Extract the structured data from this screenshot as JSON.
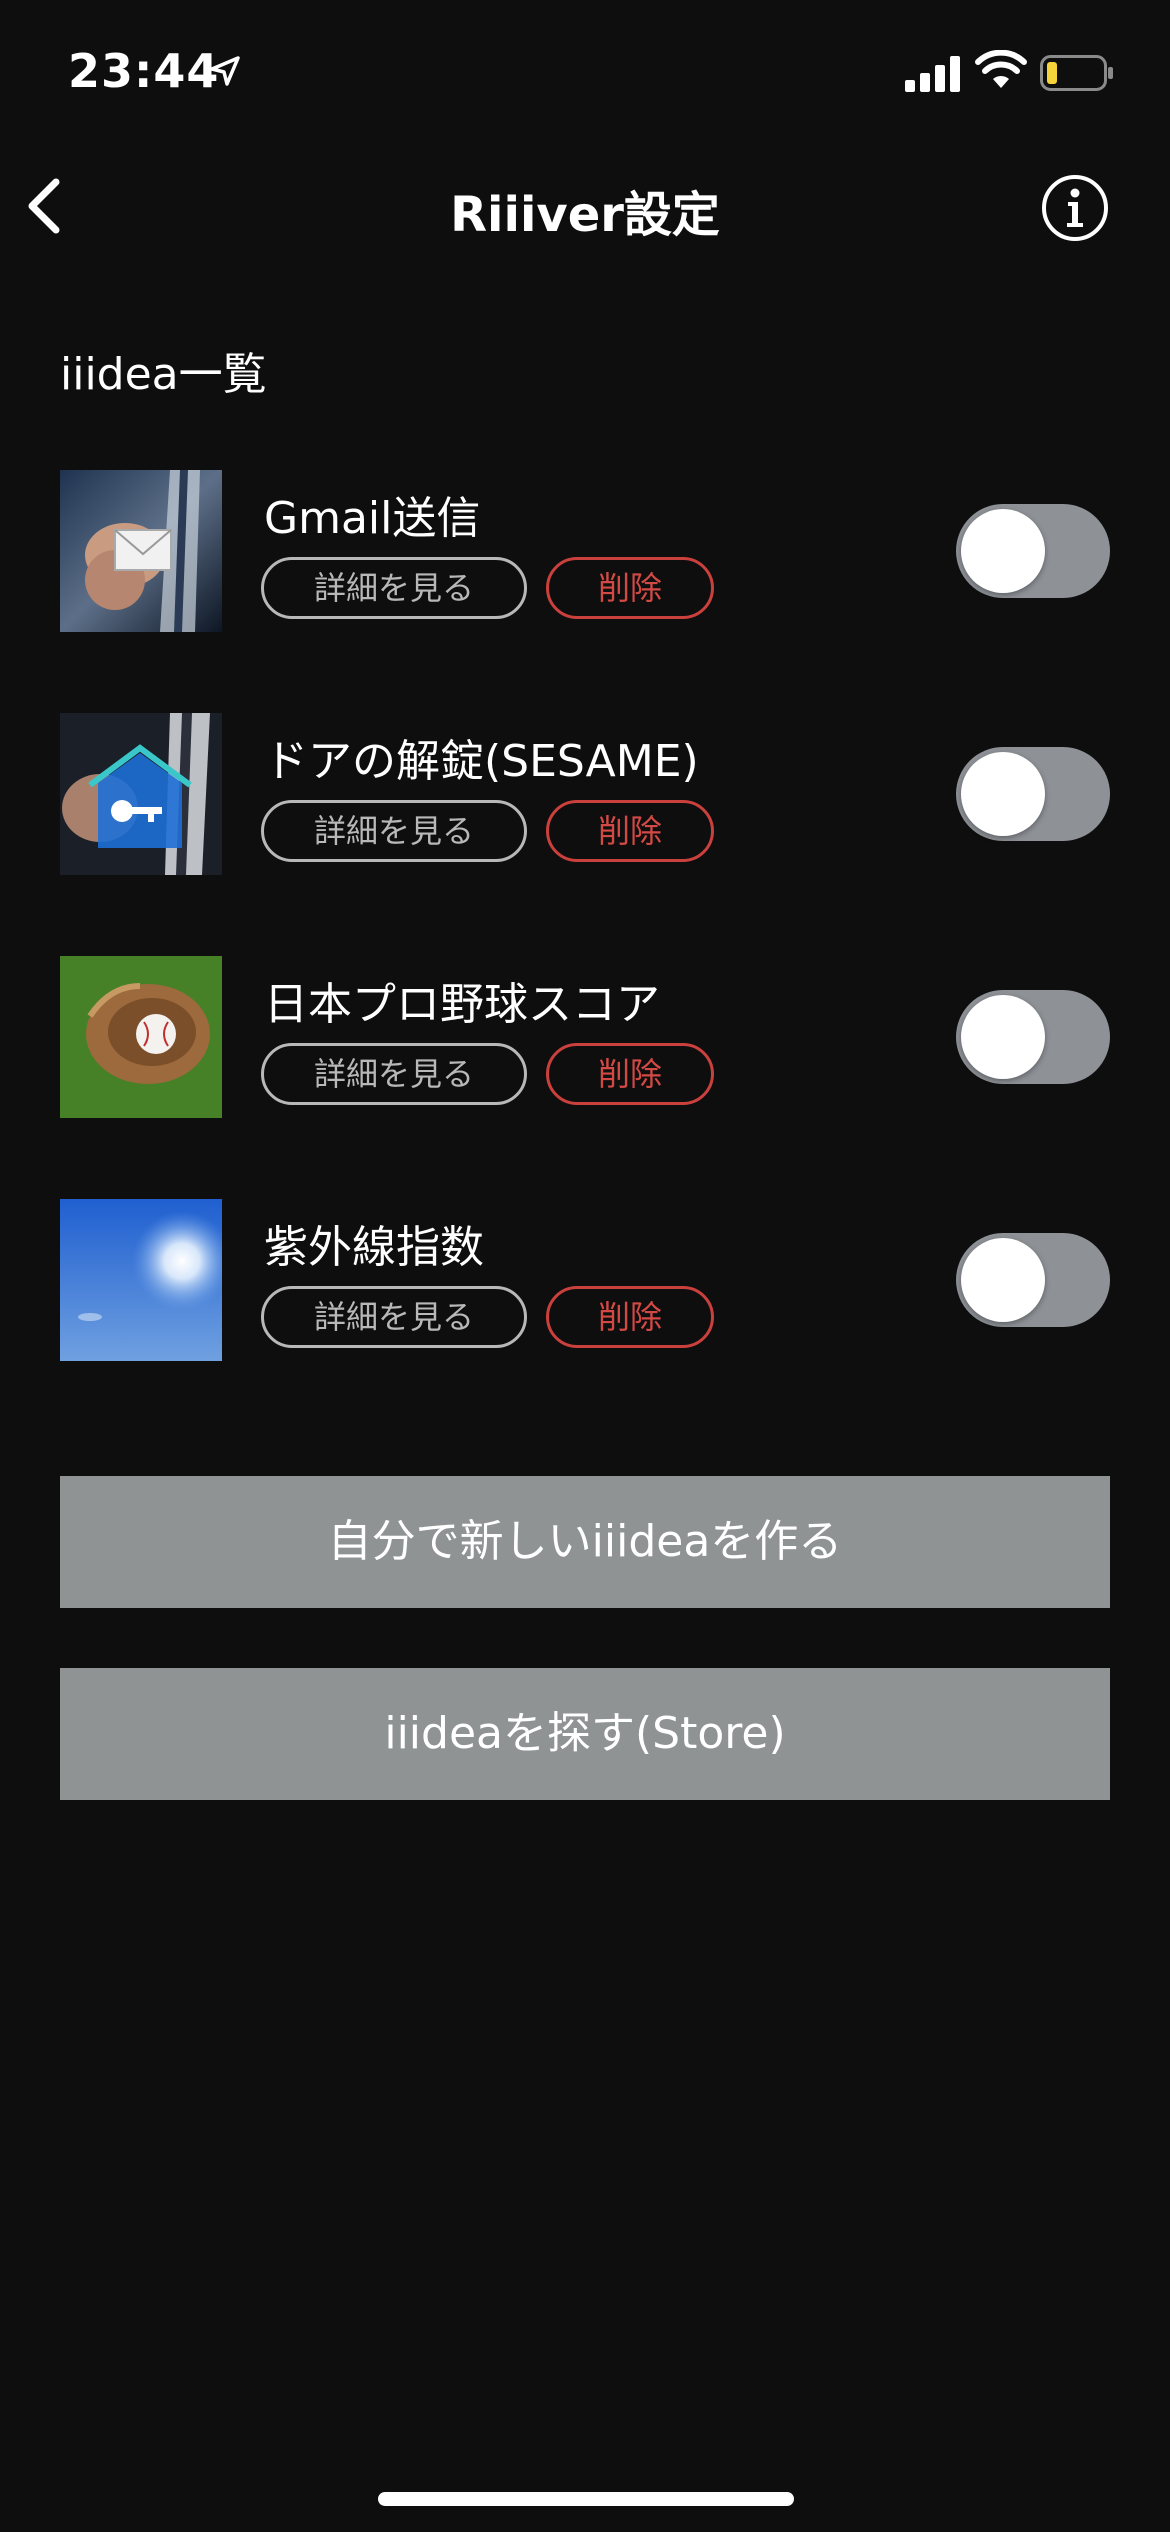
{
  "status_bar": {
    "time": "23:44",
    "icons": [
      "location-arrow-icon",
      "signal-icon",
      "wifi-icon",
      "battery-icon"
    ],
    "battery_color": "#f5d33b"
  },
  "header": {
    "title": "Riiiver設定",
    "back_icon": "chevron-left-icon",
    "info_icon": "info-icon"
  },
  "section": {
    "title": "iiidea一覧"
  },
  "ideas": [
    {
      "name": "Gmail送信",
      "detail_label": "詳細を見る",
      "delete_label": "削除",
      "enabled": false,
      "thumbnail": "hand-envelope-image"
    },
    {
      "name": "ドアの解錠(SESAME)",
      "detail_label": "詳細を見る",
      "delete_label": "削除",
      "enabled": false,
      "thumbnail": "hand-house-key-image"
    },
    {
      "name": "日本プロ野球スコア",
      "detail_label": "詳細を見る",
      "delete_label": "削除",
      "enabled": false,
      "thumbnail": "baseball-glove-image"
    },
    {
      "name": "紫外線指数",
      "detail_label": "詳細を見る",
      "delete_label": "削除",
      "enabled": false,
      "thumbnail": "sun-sky-image"
    }
  ],
  "actions": {
    "create_label": "自分で新しいiiideaを作る",
    "store_label": "iiideaを探す(Store)"
  },
  "colors": {
    "background": "#0e0e0e",
    "delete": "#d34a45",
    "toggle_off": "#8e9297",
    "button_bg": "#8f9394"
  }
}
